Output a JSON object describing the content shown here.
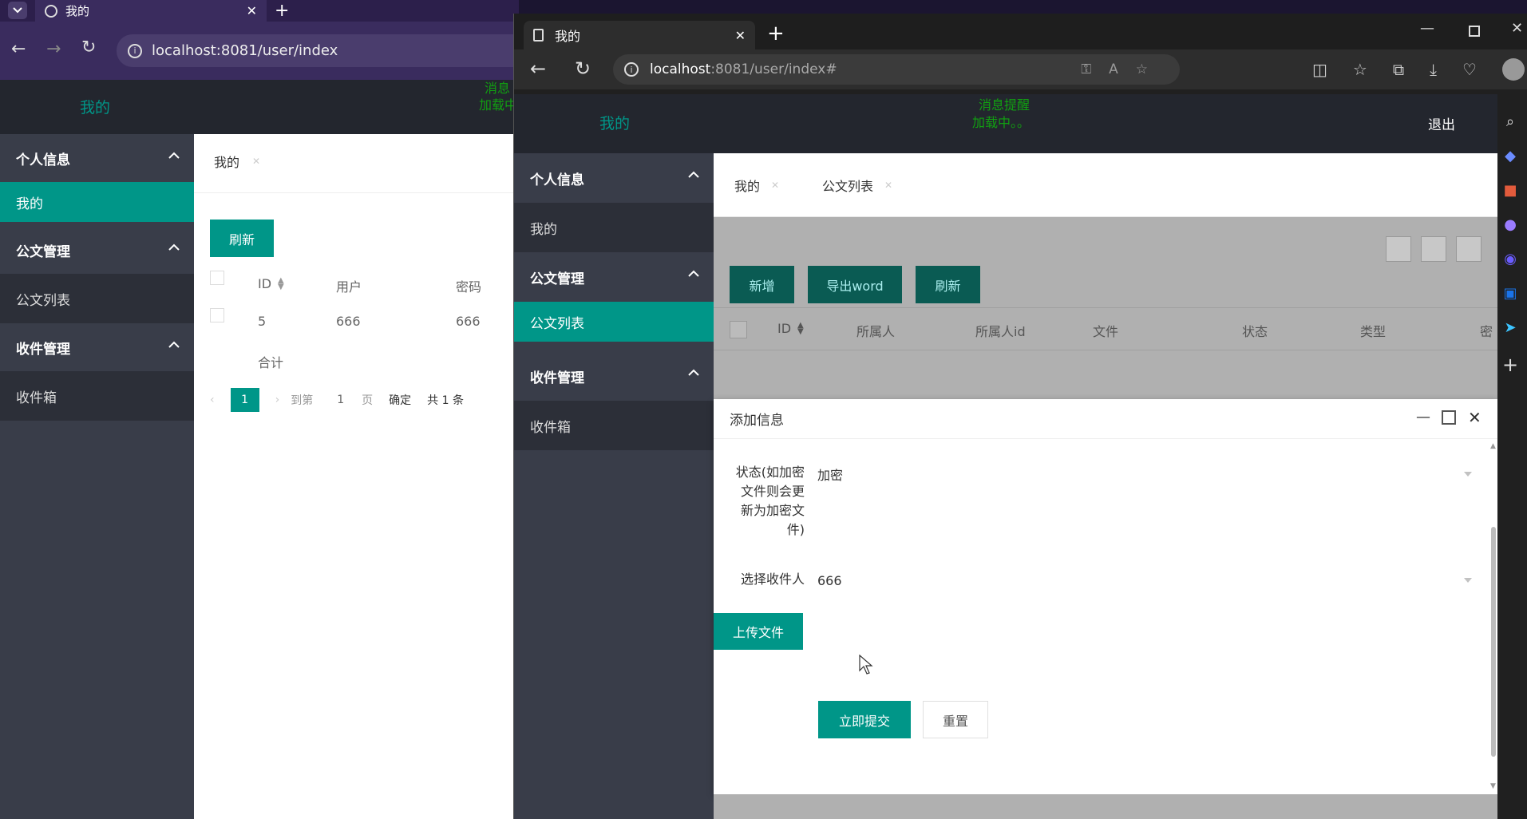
{
  "back_window": {
    "tab_title": "我的",
    "address": "localhost:8081/user/index",
    "header_title": "我的",
    "header_notice_partial": "消息",
    "header_notice_partial2": "加载中",
    "sidebar": {
      "groups": [
        {
          "label": "个人信息",
          "items": [
            "我的"
          ]
        },
        {
          "label": "公文管理",
          "items": [
            "公文列表"
          ]
        },
        {
          "label": "收件管理",
          "items": [
            "收件箱"
          ]
        }
      ]
    },
    "content_tab": "我的",
    "refresh_button": "刷新",
    "table": {
      "columns": [
        "ID",
        "用户",
        "密码"
      ],
      "rows": [
        [
          "5",
          "666",
          "666"
        ]
      ],
      "total_label": "合计"
    },
    "pagination": {
      "current": "1",
      "goto_label": "到第",
      "goto_value": "1",
      "page_label": "页",
      "confirm": "确定",
      "total": "共 1 条"
    }
  },
  "front_window": {
    "tab_title": "我的",
    "address_host": "localhost",
    "address_rest": ":8081/user/index#",
    "header": {
      "title": "我的",
      "notice_line1": "消息提醒",
      "notice_line2": "加载中。。",
      "logout": "退出"
    },
    "sidebar": {
      "group1": "个人信息",
      "group1_item": "我的",
      "group2": "公文管理",
      "group2_item": "公文列表",
      "group3": "收件管理",
      "group3_item": "收件箱"
    },
    "tabs": [
      "我的",
      "公文列表"
    ],
    "toolbar_buttons": [
      "新增",
      "导出word",
      "刷新"
    ],
    "table_columns": [
      "ID",
      "所属人",
      "所属人id",
      "文件",
      "状态",
      "类型",
      "密"
    ],
    "dialog": {
      "title": "添加信息",
      "status_label": "状态(如加密文件则会更新为加密文件)",
      "status_label_lines": [
        "状态(如加密",
        "文件则会更",
        "新为加密文",
        "件)"
      ],
      "status_value": "加密",
      "recipient_label": "选择收件人",
      "recipient_value": "666",
      "upload_button": "上传文件",
      "submit_button": "立即提交",
      "reset_button": "重置"
    }
  },
  "colors": {
    "accent": "#009688",
    "header_bg": "#23262e",
    "sidebar_bg": "#393d49",
    "sidebar_sub_bg": "#2c2f38"
  }
}
